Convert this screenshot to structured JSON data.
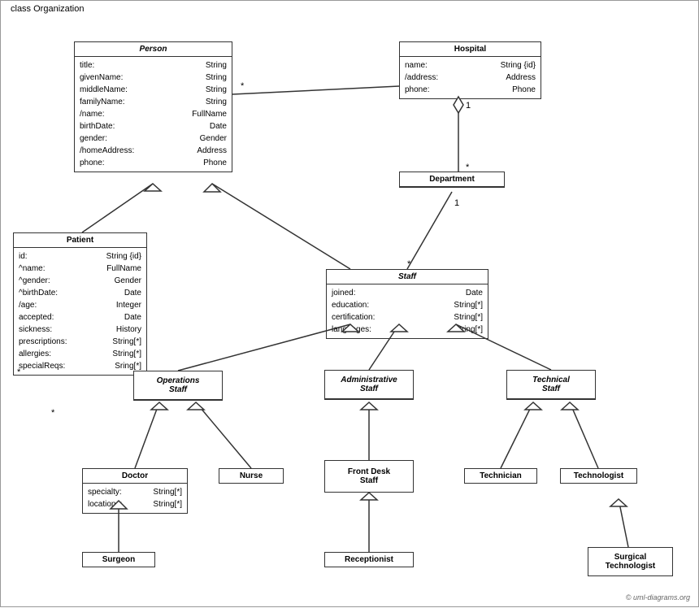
{
  "diagram": {
    "title": "class Organization",
    "classes": {
      "person": {
        "name": "Person",
        "italic": true,
        "attrs": [
          {
            "name": "title:",
            "type": "String"
          },
          {
            "name": "givenName:",
            "type": "String"
          },
          {
            "name": "middleName:",
            "type": "String"
          },
          {
            "name": "familyName:",
            "type": "String"
          },
          {
            "name": "/name:",
            "type": "FullName"
          },
          {
            "name": "birthDate:",
            "type": "Date"
          },
          {
            "name": "gender:",
            "type": "Gender"
          },
          {
            "name": "/homeAddress:",
            "type": "Address"
          },
          {
            "name": "phone:",
            "type": "Phone"
          }
        ]
      },
      "hospital": {
        "name": "Hospital",
        "italic": false,
        "attrs": [
          {
            "name": "name:",
            "type": "String {id}"
          },
          {
            "name": "/address:",
            "type": "Address"
          },
          {
            "name": "phone:",
            "type": "Phone"
          }
        ]
      },
      "department": {
        "name": "Department",
        "italic": false,
        "attrs": []
      },
      "staff": {
        "name": "Staff",
        "italic": true,
        "attrs": [
          {
            "name": "joined:",
            "type": "Date"
          },
          {
            "name": "education:",
            "type": "String[*]"
          },
          {
            "name": "certification:",
            "type": "String[*]"
          },
          {
            "name": "languages:",
            "type": "String[*]"
          }
        ]
      },
      "patient": {
        "name": "Patient",
        "italic": false,
        "attrs": [
          {
            "name": "id:",
            "type": "String {id}"
          },
          {
            "name": "^name:",
            "type": "FullName"
          },
          {
            "name": "^gender:",
            "type": "Gender"
          },
          {
            "name": "^birthDate:",
            "type": "Date"
          },
          {
            "name": "/age:",
            "type": "Integer"
          },
          {
            "name": "accepted:",
            "type": "Date"
          },
          {
            "name": "sickness:",
            "type": "History"
          },
          {
            "name": "prescriptions:",
            "type": "String[*]"
          },
          {
            "name": "allergies:",
            "type": "String[*]"
          },
          {
            "name": "specialReqs:",
            "type": "Sring[*]"
          }
        ]
      },
      "operations_staff": {
        "name": "Operations\nStaff",
        "italic": true,
        "attrs": []
      },
      "administrative_staff": {
        "name": "Administrative\nStaff",
        "italic": true,
        "attrs": []
      },
      "technical_staff": {
        "name": "Technical\nStaff",
        "italic": true,
        "attrs": []
      },
      "doctor": {
        "name": "Doctor",
        "italic": false,
        "attrs": [
          {
            "name": "specialty:",
            "type": "String[*]"
          },
          {
            "name": "locations:",
            "type": "String[*]"
          }
        ]
      },
      "nurse": {
        "name": "Nurse",
        "italic": false,
        "attrs": []
      },
      "front_desk_staff": {
        "name": "Front Desk\nStaff",
        "italic": false,
        "attrs": []
      },
      "technician": {
        "name": "Technician",
        "italic": false,
        "attrs": []
      },
      "technologist": {
        "name": "Technologist",
        "italic": false,
        "attrs": []
      },
      "surgeon": {
        "name": "Surgeon",
        "italic": false,
        "attrs": []
      },
      "receptionist": {
        "name": "Receptionist",
        "italic": false,
        "attrs": []
      },
      "surgical_technologist": {
        "name": "Surgical\nTechnologist",
        "italic": false,
        "attrs": []
      }
    },
    "copyright": "© uml-diagrams.org"
  }
}
